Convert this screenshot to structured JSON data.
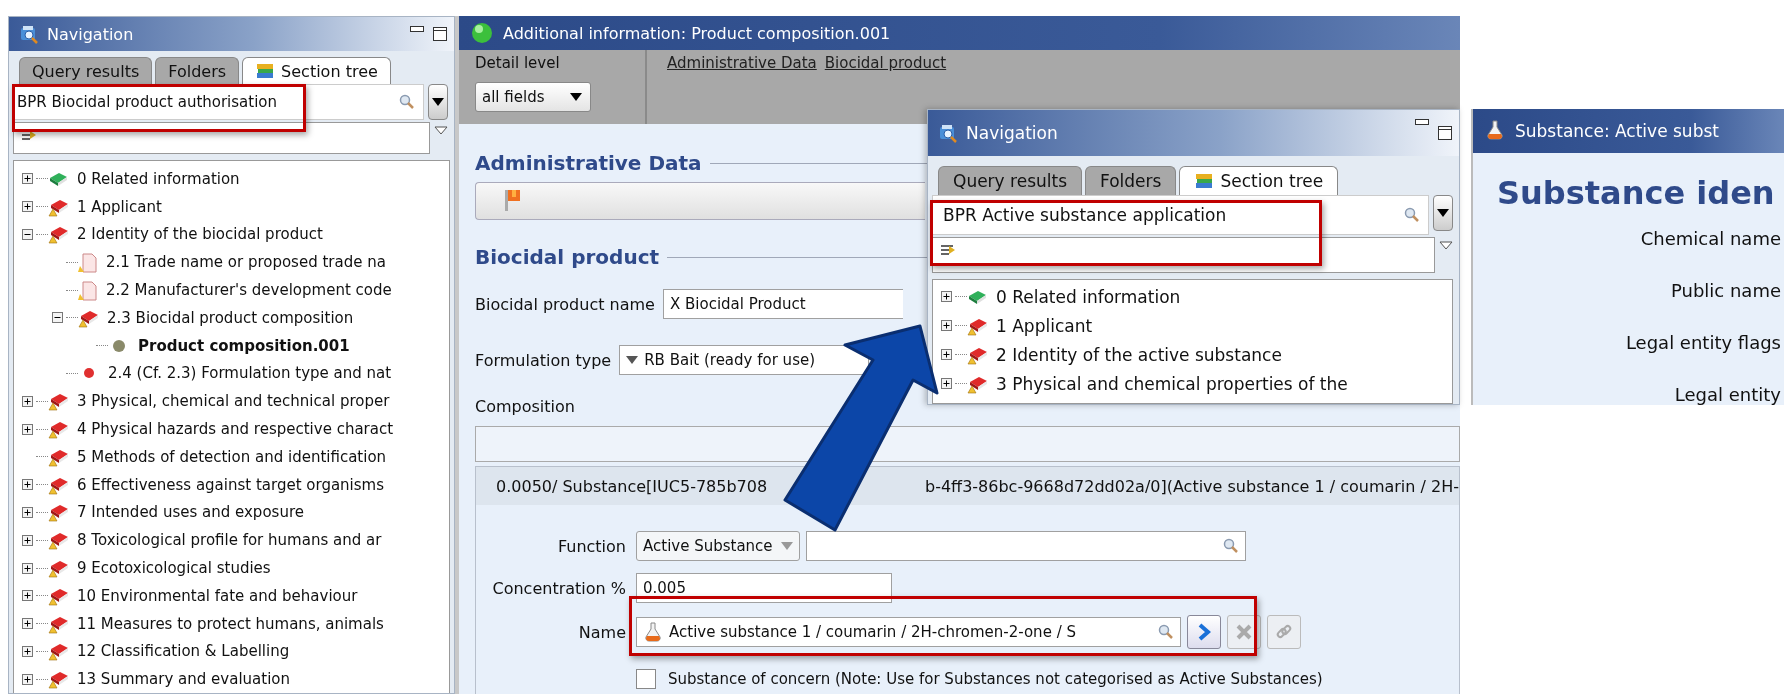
{
  "left_navigation": {
    "title": "Navigation",
    "tabs": [
      {
        "label": "Query results",
        "selected": false
      },
      {
        "label": "Folders",
        "selected": false
      },
      {
        "label": "Section tree",
        "selected": true
      }
    ],
    "search": {
      "value": "BPR Biocidal product authorisation"
    },
    "tree": [
      {
        "kind": "related",
        "label": "0 Related information",
        "expanded": false,
        "selected": false
      },
      {
        "kind": "section",
        "label": "1 Applicant",
        "expanded": false,
        "selected": false
      },
      {
        "kind": "section",
        "label": "2 Identity of the biocidal product",
        "expanded": true,
        "selected": false,
        "children": [
          {
            "kind": "document",
            "label": "2.1 Trade name or proposed trade na",
            "selected": false
          },
          {
            "kind": "document",
            "label": "2.2 Manufacturer's development code",
            "selected": false
          },
          {
            "kind": "section",
            "label": "2.3 Biocidal product composition",
            "expanded": true,
            "selected": false,
            "children": [
              {
                "kind": "record",
                "label": "Product composition.001",
                "selected": true
              }
            ]
          },
          {
            "kind": "missing",
            "label": "2.4 (Cf. 2.3) Formulation type and nat",
            "selected": false
          }
        ]
      },
      {
        "kind": "section",
        "label": "3 Physical, chemical and technical proper",
        "expanded": false,
        "selected": false
      },
      {
        "kind": "section",
        "label": "4 Physical hazards and respective charact",
        "expanded": false,
        "selected": false
      },
      {
        "kind": "section",
        "label": "5 Methods of detection and identification",
        "selected": false
      },
      {
        "kind": "section",
        "label": "6 Effectiveness against target organisms",
        "expanded": false,
        "selected": false
      },
      {
        "kind": "section",
        "label": "7 Intended uses and exposure",
        "expanded": false,
        "selected": false
      },
      {
        "kind": "section",
        "label": "8 Toxicological profile for humans and ar",
        "expanded": false,
        "selected": false
      },
      {
        "kind": "section",
        "label": "9 Ecotoxicological studies",
        "expanded": false,
        "selected": false
      },
      {
        "kind": "section",
        "label": "10 Environmental fate and behaviour",
        "expanded": false,
        "selected": false
      },
      {
        "kind": "section",
        "label": "11 Measures to protect humans, animals",
        "expanded": false,
        "selected": false
      },
      {
        "kind": "section",
        "label": "12 Classification & Labelling",
        "expanded": false,
        "selected": false
      },
      {
        "kind": "section",
        "label": "13 Summary and evaluation",
        "expanded": false,
        "selected": false
      }
    ]
  },
  "editor": {
    "title": "Additional information: Product composition.001",
    "detail_level": {
      "label": "Detail level",
      "value": "all fields"
    },
    "links": [
      "Administrative Data",
      "Biocidal product"
    ],
    "admin_heading": "Administrative Data",
    "biocidal_heading": "Biocidal product",
    "product_name": {
      "label": "Biocidal product name",
      "value": "X Biocidal Product"
    },
    "formulation_type": {
      "label": "Formulation type",
      "value": "RB Bait (ready for use)"
    },
    "composition_label": "Composition",
    "entry": {
      "header_parts": [
        "0.0050/ Substance[IUC5-785b708",
        "b-4ff3-86bc-9668d72dd02a/0](Active substance 1 / coumarin / 2H-"
      ],
      "function": {
        "label": "Function",
        "value": "Active Substance"
      },
      "concentration": {
        "label": "Concentration %",
        "value": "0.005"
      },
      "name": {
        "label": "Name",
        "value": "Active substance 1 / coumarin / 2H-chromen-2-one / S"
      },
      "concern": {
        "label": "Substance of concern (Note: Use for Substances not categorised as Active Substances)",
        "checked": false
      }
    }
  },
  "overlay_navigation": {
    "title": "Navigation",
    "tabs": [
      {
        "label": "Query results",
        "selected": false
      },
      {
        "label": "Folders",
        "selected": false
      },
      {
        "label": "Section tree",
        "selected": true
      }
    ],
    "search": {
      "value": "BPR Active substance application"
    },
    "tree": [
      {
        "kind": "related",
        "label": "0 Related information",
        "expanded": false,
        "selected": false
      },
      {
        "kind": "section",
        "label": "1 Applicant",
        "expanded": false,
        "selected": false
      },
      {
        "kind": "section",
        "label": "2 Identity of the active substance",
        "expanded": false,
        "selected": false
      },
      {
        "kind": "section",
        "label": "3 Physical and chemical properties of the",
        "expanded": false,
        "selected": false
      }
    ]
  },
  "substance_window": {
    "title": "Substance: Active subst",
    "heading": "Substance iden",
    "labels": [
      "Chemical name",
      "Public name",
      "Legal entity flags",
      "Legal entity"
    ]
  }
}
